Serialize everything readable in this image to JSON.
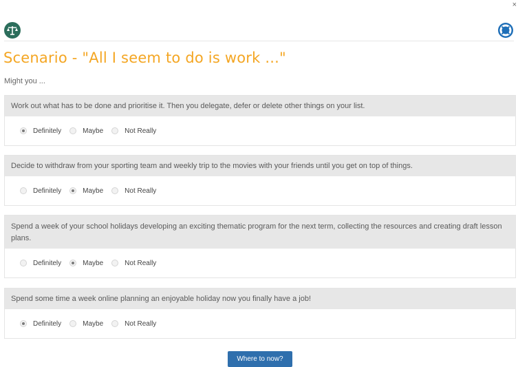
{
  "window": {
    "close_glyph": "×"
  },
  "header": {
    "logo_icon": "scales-icon",
    "help_icon": "lifebuoy-icon"
  },
  "title": "Scenario - \"All I seem to do is work ...\"",
  "intro": "Might you ...",
  "option_labels": [
    "Definitely",
    "Maybe",
    "Not Really"
  ],
  "questions": [
    {
      "text": "Work out what has to be done and prioritise it. Then you delegate, defer or delete other things on your list.",
      "selected": "Definitely"
    },
    {
      "text": "Decide to withdraw from your sporting team and weekly trip to the movies with your friends until you get on top of things.",
      "selected": "Maybe"
    },
    {
      "text": "Spend a week of your school holidays developing an exciting thematic program for the next term, collecting the resources and creating draft lesson plans.",
      "selected": "Maybe"
    },
    {
      "text": "Spend some time a week online planning an enjoyable holiday now you finally have a job!",
      "selected": "Definitely"
    }
  ],
  "next_button": "Where to now?",
  "colors": {
    "title": "#f4a623",
    "button": "#2f6fad",
    "logo": "#2c6e5c",
    "help": "#1f6fb8"
  }
}
